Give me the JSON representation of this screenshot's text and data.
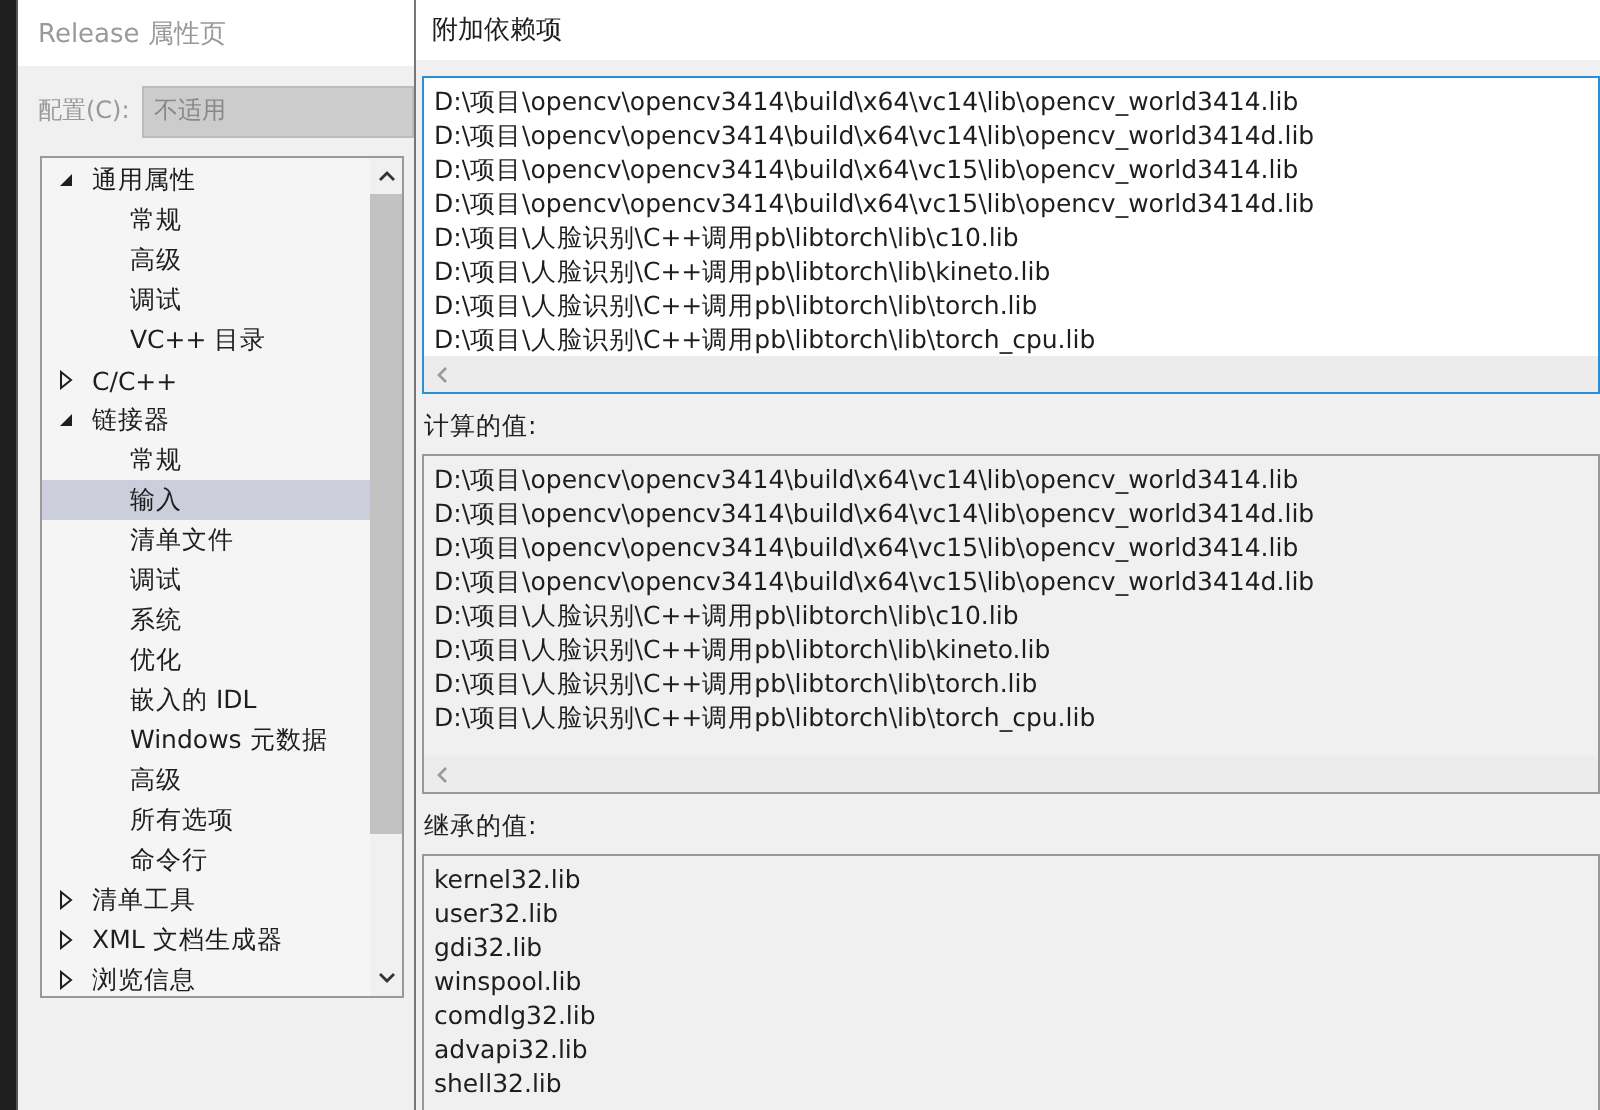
{
  "property_pages": {
    "title": "Release 属性页",
    "config_label": "配置(C):",
    "config_value": "不适用",
    "config_disabled": true,
    "tree": [
      {
        "label": "通用属性",
        "expanded": true,
        "selected": false,
        "children": [
          {
            "label": "常规",
            "selected": false
          },
          {
            "label": "高级",
            "selected": false
          },
          {
            "label": "调试",
            "selected": false
          },
          {
            "label": "VC++ 目录",
            "selected": false
          }
        ]
      },
      {
        "label": "C/C++",
        "expanded": false,
        "selected": false
      },
      {
        "label": "链接器",
        "expanded": true,
        "selected": false,
        "children": [
          {
            "label": "常规",
            "selected": false
          },
          {
            "label": "输入",
            "selected": true
          },
          {
            "label": "清单文件",
            "selected": false
          },
          {
            "label": "调试",
            "selected": false
          },
          {
            "label": "系统",
            "selected": false
          },
          {
            "label": "优化",
            "selected": false
          },
          {
            "label": "嵌入的 IDL",
            "selected": false
          },
          {
            "label": "Windows 元数据",
            "selected": false
          },
          {
            "label": "高级",
            "selected": false
          },
          {
            "label": "所有选项",
            "selected": false
          },
          {
            "label": "命令行",
            "selected": false
          }
        ]
      },
      {
        "label": "清单工具",
        "expanded": false,
        "selected": false
      },
      {
        "label": "XML 文档生成器",
        "expanded": false,
        "selected": false
      },
      {
        "label": "浏览信息",
        "expanded": false,
        "selected": false
      }
    ]
  },
  "dialog": {
    "title": "附加依赖项",
    "entries": [
      "D:\\项目\\opencv\\opencv3414\\build\\x64\\vc14\\lib\\opencv_world3414.lib",
      "D:\\项目\\opencv\\opencv3414\\build\\x64\\vc14\\lib\\opencv_world3414d.lib",
      "D:\\项目\\opencv\\opencv3414\\build\\x64\\vc15\\lib\\opencv_world3414.lib",
      "D:\\项目\\opencv\\opencv3414\\build\\x64\\vc15\\lib\\opencv_world3414d.lib",
      "D:\\项目\\人脸识别\\C++调用pb\\libtorch\\lib\\c10.lib",
      "D:\\项目\\人脸识别\\C++调用pb\\libtorch\\lib\\kineto.lib",
      "D:\\项目\\人脸识别\\C++调用pb\\libtorch\\lib\\torch.lib",
      "D:\\项目\\人脸识别\\C++调用pb\\libtorch\\lib\\torch_cpu.lib"
    ],
    "computed_label": "计算的值:",
    "computed_values": [
      "D:\\项目\\opencv\\opencv3414\\build\\x64\\vc14\\lib\\opencv_world3414.lib",
      "D:\\项目\\opencv\\opencv3414\\build\\x64\\vc14\\lib\\opencv_world3414d.lib",
      "D:\\项目\\opencv\\opencv3414\\build\\x64\\vc15\\lib\\opencv_world3414.lib",
      "D:\\项目\\opencv\\opencv3414\\build\\x64\\vc15\\lib\\opencv_world3414d.lib",
      "D:\\项目\\人脸识别\\C++调用pb\\libtorch\\lib\\c10.lib",
      "D:\\项目\\人脸识别\\C++调用pb\\libtorch\\lib\\kineto.lib",
      "D:\\项目\\人脸识别\\C++调用pb\\libtorch\\lib\\torch.lib",
      "D:\\项目\\人脸识别\\C++调用pb\\libtorch\\lib\\torch_cpu.lib"
    ],
    "inherited_label": "继承的值:",
    "inherited_values": [
      "kernel32.lib",
      "user32.lib",
      "gdi32.lib",
      "winspool.lib",
      "comdlg32.lib",
      "advapi32.lib",
      "shell32.lib"
    ]
  }
}
